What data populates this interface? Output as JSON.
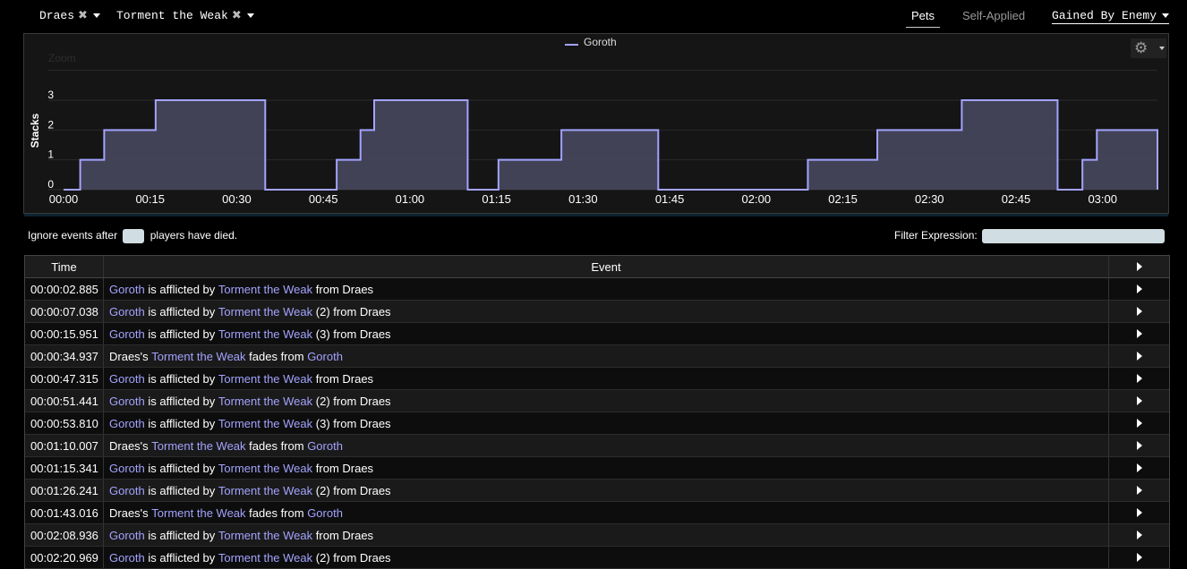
{
  "filters": [
    {
      "label": "Draes",
      "remove_icon": "close-icon"
    },
    {
      "label": "Torment the Weak",
      "remove_icon": "close-icon"
    }
  ],
  "tabs": {
    "pets": "Pets",
    "self_applied": "Self-Applied",
    "gained_by": "Gained By Enemy"
  },
  "chart_data": {
    "type": "area",
    "step": true,
    "series": [
      {
        "name": "Goroth",
        "color": "#a3a3ff",
        "points": [
          [
            0,
            0
          ],
          [
            2.885,
            1
          ],
          [
            7.038,
            2
          ],
          [
            15.951,
            3
          ],
          [
            34.937,
            0
          ],
          [
            47.315,
            1
          ],
          [
            51.441,
            2
          ],
          [
            53.81,
            3
          ],
          [
            70.007,
            0
          ],
          [
            75.341,
            1
          ],
          [
            86.241,
            2
          ],
          [
            103.016,
            0
          ],
          [
            128.936,
            1
          ],
          [
            140.969,
            2
          ],
          [
            155.6,
            3
          ],
          [
            172.2,
            0
          ],
          [
            176.5,
            1
          ],
          [
            179.0,
            2
          ],
          [
            189.5,
            0
          ]
        ]
      }
    ],
    "zoom_label": "Zoom",
    "ylabel": "Stacks",
    "yticks": [
      0,
      1,
      2,
      3
    ],
    "ylim": [
      0,
      3
    ],
    "xlim": [
      0,
      189.5
    ],
    "xticks": [
      "00:00",
      "00:15",
      "00:30",
      "00:45",
      "01:00",
      "01:15",
      "01:30",
      "01:45",
      "02:00",
      "02:15",
      "02:30",
      "02:45",
      "03:00"
    ],
    "xtick_values": [
      0,
      15,
      30,
      45,
      60,
      75,
      90,
      105,
      120,
      135,
      150,
      165,
      180
    ],
    "legend": "top-center",
    "grid": true,
    "settings_icon": "gear-icon"
  },
  "ignore_events": {
    "before": "Ignore events after",
    "after": "players have died.",
    "value": ""
  },
  "filter_expression": {
    "label": "Filter Expression:",
    "value": ""
  },
  "table": {
    "headers": {
      "time": "Time",
      "event": "Event"
    },
    "rows": [
      {
        "time": "00:00:02.885",
        "parts": [
          {
            "t": "Goroth",
            "c": "tgt"
          },
          {
            "t": " is afflicted by ",
            "c": "plain"
          },
          {
            "t": "Torment the Weak",
            "c": "abil"
          },
          {
            "t": " from Draes",
            "c": "plain"
          }
        ]
      },
      {
        "time": "00:00:07.038",
        "parts": [
          {
            "t": "Goroth",
            "c": "tgt"
          },
          {
            "t": " is afflicted by ",
            "c": "plain"
          },
          {
            "t": "Torment the Weak",
            "c": "abil"
          },
          {
            "t": " (2) from Draes",
            "c": "plain"
          }
        ]
      },
      {
        "time": "00:00:15.951",
        "parts": [
          {
            "t": "Goroth",
            "c": "tgt"
          },
          {
            "t": " is afflicted by ",
            "c": "plain"
          },
          {
            "t": "Torment the Weak",
            "c": "abil"
          },
          {
            "t": " (3) from Draes",
            "c": "plain"
          }
        ]
      },
      {
        "time": "00:00:34.937",
        "parts": [
          {
            "t": "Draes's ",
            "c": "plain"
          },
          {
            "t": "Torment the Weak",
            "c": "abil"
          },
          {
            "t": " fades from ",
            "c": "plain"
          },
          {
            "t": "Goroth",
            "c": "tgt"
          }
        ]
      },
      {
        "time": "00:00:47.315",
        "parts": [
          {
            "t": "Goroth",
            "c": "tgt"
          },
          {
            "t": " is afflicted by ",
            "c": "plain"
          },
          {
            "t": "Torment the Weak",
            "c": "abil"
          },
          {
            "t": " from Draes",
            "c": "plain"
          }
        ]
      },
      {
        "time": "00:00:51.441",
        "parts": [
          {
            "t": "Goroth",
            "c": "tgt"
          },
          {
            "t": " is afflicted by ",
            "c": "plain"
          },
          {
            "t": "Torment the Weak",
            "c": "abil"
          },
          {
            "t": " (2) from Draes",
            "c": "plain"
          }
        ]
      },
      {
        "time": "00:00:53.810",
        "parts": [
          {
            "t": "Goroth",
            "c": "tgt"
          },
          {
            "t": " is afflicted by ",
            "c": "plain"
          },
          {
            "t": "Torment the Weak",
            "c": "abil"
          },
          {
            "t": " (3) from Draes",
            "c": "plain"
          }
        ]
      },
      {
        "time": "00:01:10.007",
        "parts": [
          {
            "t": "Draes's ",
            "c": "plain"
          },
          {
            "t": "Torment the Weak",
            "c": "abil"
          },
          {
            "t": " fades from ",
            "c": "plain"
          },
          {
            "t": "Goroth",
            "c": "tgt"
          }
        ]
      },
      {
        "time": "00:01:15.341",
        "parts": [
          {
            "t": "Goroth",
            "c": "tgt"
          },
          {
            "t": " is afflicted by ",
            "c": "plain"
          },
          {
            "t": "Torment the Weak",
            "c": "abil"
          },
          {
            "t": " from Draes",
            "c": "plain"
          }
        ]
      },
      {
        "time": "00:01:26.241",
        "parts": [
          {
            "t": "Goroth",
            "c": "tgt"
          },
          {
            "t": " is afflicted by ",
            "c": "plain"
          },
          {
            "t": "Torment the Weak",
            "c": "abil"
          },
          {
            "t": " (2) from Draes",
            "c": "plain"
          }
        ]
      },
      {
        "time": "00:01:43.016",
        "parts": [
          {
            "t": "Draes's ",
            "c": "plain"
          },
          {
            "t": "Torment the Weak",
            "c": "abil"
          },
          {
            "t": " fades from ",
            "c": "plain"
          },
          {
            "t": "Goroth",
            "c": "tgt"
          }
        ]
      },
      {
        "time": "00:02:08.936",
        "parts": [
          {
            "t": "Goroth",
            "c": "tgt"
          },
          {
            "t": " is afflicted by ",
            "c": "plain"
          },
          {
            "t": "Torment the Weak",
            "c": "abil"
          },
          {
            "t": " from Draes",
            "c": "plain"
          }
        ]
      },
      {
        "time": "00:02:20.969",
        "parts": [
          {
            "t": "Goroth",
            "c": "tgt"
          },
          {
            "t": " is afflicted by ",
            "c": "plain"
          },
          {
            "t": "Torment the Weak",
            "c": "abil"
          },
          {
            "t": " (2) from Draes",
            "c": "plain"
          }
        ]
      }
    ]
  }
}
